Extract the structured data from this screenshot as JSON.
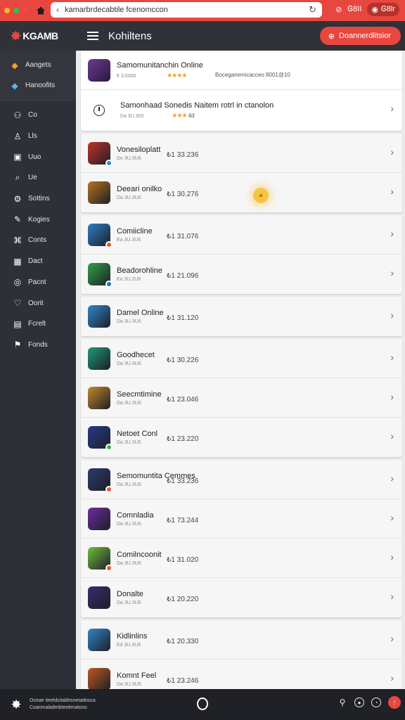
{
  "browser": {
    "url": "kamarbrdecabtile fcenomccon",
    "account_label": "Ꮆ8II",
    "account_name": "Ꮆ8lr",
    "colors": {
      "chrome": "#e8473f"
    }
  },
  "app": {
    "logo_text": "KGAMB",
    "page_title": "Kohiltens",
    "cta_label": "Doannerdlitsior"
  },
  "sidebar": {
    "top_items": [
      {
        "label": "Aangets",
        "icon": "shield-icon"
      },
      {
        "label": "Hanoofits",
        "icon": "gem-icon"
      }
    ],
    "items": [
      {
        "label": "Co",
        "icon": "people-icon"
      },
      {
        "label": "Lls",
        "icon": "user-icon"
      },
      {
        "label": "Uuo",
        "icon": "box-icon"
      },
      {
        "label": "Ue",
        "icon": "search-icon"
      },
      {
        "label": "Sottins",
        "icon": "gear-icon"
      },
      {
        "label": "Kogies",
        "icon": "chat-icon"
      },
      {
        "label": "Conts",
        "icon": "gamepad-icon"
      },
      {
        "label": "Dact",
        "icon": "calendar-icon"
      },
      {
        "label": "Pacnt",
        "icon": "globe-icon"
      },
      {
        "label": "Oorit",
        "icon": "heart-icon"
      },
      {
        "label": "Fcrelt",
        "icon": "doc-icon"
      },
      {
        "label": "Fonds",
        "icon": "flag-icon"
      }
    ]
  },
  "featured": [
    {
      "name": "Samomunitanchin Online",
      "sub": "€ 3.0000",
      "stars": "★★★★",
      "extra": "Boceganemicacceo 8001@10",
      "color": "#4d2a6e"
    },
    {
      "name": "Samonhaad Sonedis Naitem rotrl in ctanolon",
      "sub": "Da 3U.300",
      "stars": "★★★",
      "extra": "4d"
    }
  ],
  "games": [
    {
      "group": 1,
      "name": "Vonesiloplatt",
      "sub": "Do 3U.3U6",
      "stat": "₺1 33.236",
      "color": "#c2332b",
      "badge": "#2a8fd8"
    },
    {
      "group": 1,
      "name": "Deeari onilko",
      "sub": "Da 3U.3U6",
      "stat": "₺1 30.276",
      "color": "#b8741e",
      "badge": null
    },
    {
      "group": 2,
      "name": "Comiicline",
      "sub": "Ea 3U.3U6",
      "stat": "₺1 31.076",
      "color": "#2f7fc5",
      "badge": "#e85530"
    },
    {
      "group": 2,
      "name": "Beadorohline",
      "sub": "Ea 3U.2U6",
      "stat": "₺1 21.096",
      "color": "#2ea348",
      "badge": "#1c6fc8"
    },
    {
      "group": 3,
      "name": "Damel Online",
      "sub": "Da 3U.3U6",
      "stat": "₺1 31.120",
      "color": "#2f88c9",
      "badge": null
    },
    {
      "group": 4,
      "name": "Goodhecet",
      "sub": "Da 3U.3U6",
      "stat": "₺1 30.226",
      "color": "#1f9a77",
      "badge": null
    },
    {
      "group": 4,
      "name": "Seecmtimine",
      "sub": "Da 3U.3U6",
      "stat": "₺1 23.046",
      "color": "#c28a2a",
      "badge": null
    },
    {
      "group": 4,
      "name": "Netoet Conl",
      "sub": "Da 3U.3U6",
      "stat": "₺1 23.220",
      "color": "#263b88",
      "badge": "#3cb44a"
    },
    {
      "group": 5,
      "name": "Semomuntita Cemmes",
      "sub": "Da 3U.3U6",
      "stat": "₺1 33.236",
      "color": "#2c3a6e",
      "badge": "#e85530"
    },
    {
      "group": 5,
      "name": "Comnladia",
      "sub": "Da 3U.3U6",
      "stat": "₺1 73.244",
      "color": "#6e2aa0",
      "badge": null
    },
    {
      "group": 5,
      "name": "Comilncoonit",
      "sub": "Da 3U.3U6",
      "stat": "₺1 31.020",
      "color": "#6fbf3a",
      "badge": "#e85530"
    },
    {
      "group": 5,
      "name": "Donalte",
      "sub": "Da 3U.3U6",
      "stat": "₺1 20.220",
      "color": "#3a2a6e",
      "badge": null
    },
    {
      "group": 6,
      "name": "Kidlinlins",
      "sub": "Ed 3U.3U6",
      "stat": "₺1 20.330",
      "color": "#2f88c9",
      "badge": null
    },
    {
      "group": 6,
      "name": "Komnt Feel",
      "sub": "Da 3U.3U6",
      "stat": "₺1 23.246",
      "color": "#c05a1e",
      "badge": null
    }
  ],
  "taskbar": {
    "line1": "Oceae tieeldcitabhsnetadosca",
    "line2": "Coanmaladmbteeitmatoso"
  }
}
